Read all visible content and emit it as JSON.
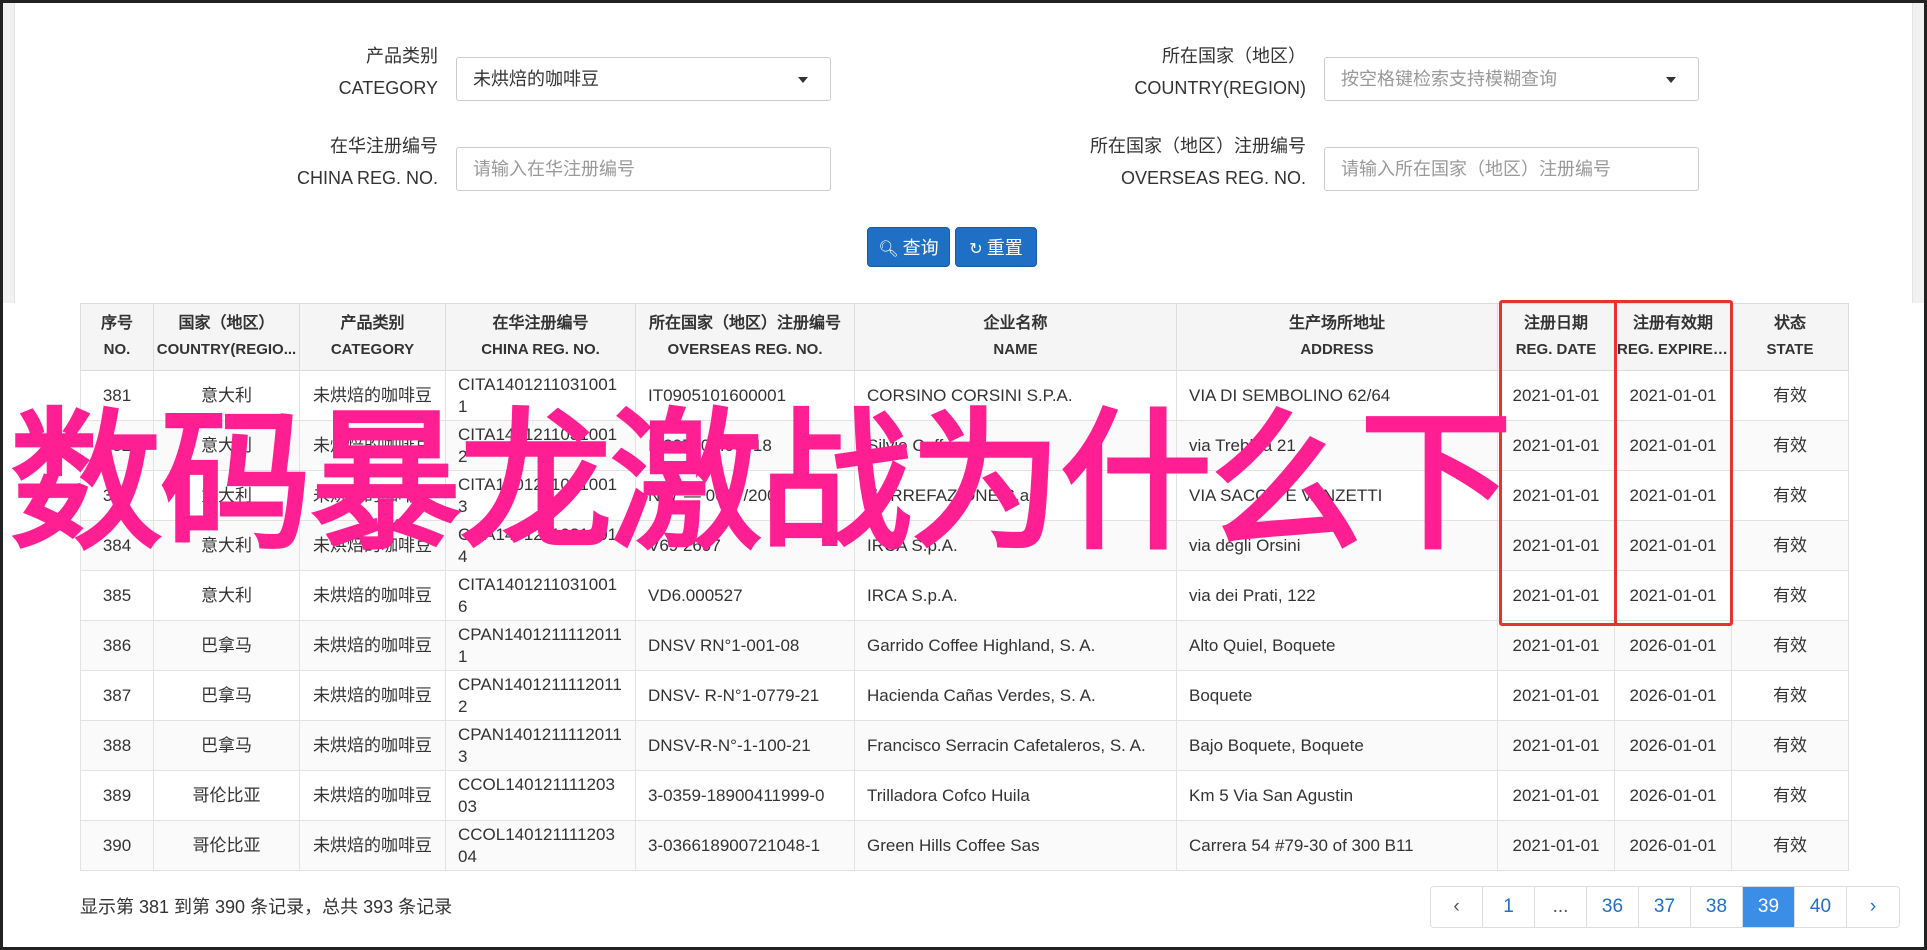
{
  "filters": {
    "category_label_cn": "产品类别",
    "category_label_en": "CATEGORY",
    "category_value": "未烘焙的咖啡豆",
    "country_label_cn": "所在国家（地区）",
    "country_label_en": "COUNTRY(REGION)",
    "country_placeholder": "按空格键检索支持模糊查询",
    "china_reg_label_cn": "在华注册编号",
    "china_reg_label_en": "CHINA REG. NO.",
    "china_reg_placeholder": "请输入在华注册编号",
    "overseas_reg_label_cn": "所在国家（地区）注册编号",
    "overseas_reg_label_en": "OVERSEAS REG. NO.",
    "overseas_reg_placeholder": "请输入所在国家（地区）注册编号",
    "search_button": "查询",
    "reset_button": "重置"
  },
  "table": {
    "headers": [
      {
        "cn": "序号",
        "en": "NO."
      },
      {
        "cn": "国家（地区）",
        "en": "COUNTRY(REGIO..."
      },
      {
        "cn": "产品类别",
        "en": "CATEGORY"
      },
      {
        "cn": "在华注册编号",
        "en": "CHINA REG. NO."
      },
      {
        "cn": "所在国家（地区）注册编号",
        "en": "OVERSEAS REG. NO."
      },
      {
        "cn": "企业名称",
        "en": "NAME"
      },
      {
        "cn": "生产场所地址",
        "en": "ADDRESS"
      },
      {
        "cn": "注册日期",
        "en": "REG. DATE"
      },
      {
        "cn": "注册有效期",
        "en": "REG. EXPIRE ..."
      },
      {
        "cn": "状态",
        "en": "STATE"
      }
    ],
    "rows": [
      {
        "no": "381",
        "country": "意大利",
        "category": "未烘焙的咖啡豆",
        "china_reg": "CITA14012110310011",
        "overseas_reg": "IT0905101600001",
        "name": "CORSINO CORSINI S.P.A.",
        "address": "VIA DI SEMBOLINO 62/64",
        "reg_date": "2021-01-01",
        "expire": "2021-01-01",
        "state": "有效"
      },
      {
        "no": "382",
        "country": "意大利",
        "category": "未烘焙的咖啡豆",
        "china_reg": "CITA14012110310012",
        "overseas_reg": "IT205901.00718",
        "name": "Silvio Coffee",
        "address": "via Trebbia 21",
        "reg_date": "2021-01-01",
        "expire": "2021-01-01",
        "state": "有效"
      },
      {
        "no": "383",
        "country": "意大利",
        "category": "未烘焙的咖啡豆",
        "china_reg": "CITA14012110310013",
        "overseas_reg": "N. 7 — 0007/2003",
        "name": "TORREFAZIONE S.a.s.",
        "address": "VIA SACCO E VANZETTI",
        "reg_date": "2021-01-01",
        "expire": "2021-01-01",
        "state": "有效"
      },
      {
        "no": "384",
        "country": "意大利",
        "category": "未烘焙的咖啡豆",
        "china_reg": "CITA14012110310014",
        "overseas_reg": "V69 2697",
        "name": "IRCA S.p.A.",
        "address": "via degli Orsini",
        "reg_date": "2021-01-01",
        "expire": "2021-01-01",
        "state": "有效"
      },
      {
        "no": "385",
        "country": "意大利",
        "category": "未烘焙的咖啡豆",
        "china_reg": "CITA14012110310016",
        "overseas_reg": "VD6.000527",
        "name": "IRCA S.p.A.",
        "address": "via dei Prati, 122",
        "reg_date": "2021-01-01",
        "expire": "2021-01-01",
        "state": "有效"
      },
      {
        "no": "386",
        "country": "巴拿马",
        "category": "未烘焙的咖啡豆",
        "china_reg": "CPAN14012111120111",
        "overseas_reg": "DNSV RN°1-001-08",
        "name": "Garrido Coffee Highland, S. A.",
        "address": "Alto Quiel, Boquete",
        "reg_date": "2021-01-01",
        "expire": "2026-01-01",
        "state": "有效"
      },
      {
        "no": "387",
        "country": "巴拿马",
        "category": "未烘焙的咖啡豆",
        "china_reg": "CPAN14012111120112",
        "overseas_reg": "DNSV- R-N°1-0779-21",
        "name": "Hacienda Cañas Verdes, S. A.",
        "address": "Boquete",
        "reg_date": "2021-01-01",
        "expire": "2026-01-01",
        "state": "有效"
      },
      {
        "no": "388",
        "country": "巴拿马",
        "category": "未烘焙的咖啡豆",
        "china_reg": "CPAN14012111120113",
        "overseas_reg": "DNSV-R-N°-1-100-21",
        "name": "Francisco Serracin Cafetaleros, S. A.",
        "address": "Bajo Boquete, Boquete",
        "reg_date": "2021-01-01",
        "expire": "2026-01-01",
        "state": "有效"
      },
      {
        "no": "389",
        "country": "哥伦比亚",
        "category": "未烘焙的咖啡豆",
        "china_reg": "CCOL14012111120303",
        "overseas_reg": "3-0359-18900411999-0",
        "name": "Trilladora Cofco Huila",
        "address": "Km 5 Via San Agustin",
        "reg_date": "2021-01-01",
        "expire": "2026-01-01",
        "state": "有效"
      },
      {
        "no": "390",
        "country": "哥伦比亚",
        "category": "未烘焙的咖啡豆",
        "china_reg": "CCOL14012111120304",
        "overseas_reg": "3-036618900721048-1",
        "name": "Green Hills Coffee Sas",
        "address": "Carrera 54 #79-30 of 300 B11",
        "reg_date": "2021-01-01",
        "expire": "2026-01-01",
        "state": "有效"
      }
    ]
  },
  "overlay_caption": "数码暴龙激战为什么下",
  "footer": {
    "summary": "显示第 381 到第 390 条记录，总共 393 条记录"
  },
  "pagination": {
    "prev": "‹",
    "pages": [
      "1",
      "...",
      "36",
      "37",
      "38",
      "39",
      "40"
    ],
    "active": "39",
    "next": "›"
  },
  "colors": {
    "primary": "#1f6fc5",
    "highlight_box": "#e5342b",
    "overlay": "#ff1f93",
    "active_page": "#3a8ee6"
  }
}
